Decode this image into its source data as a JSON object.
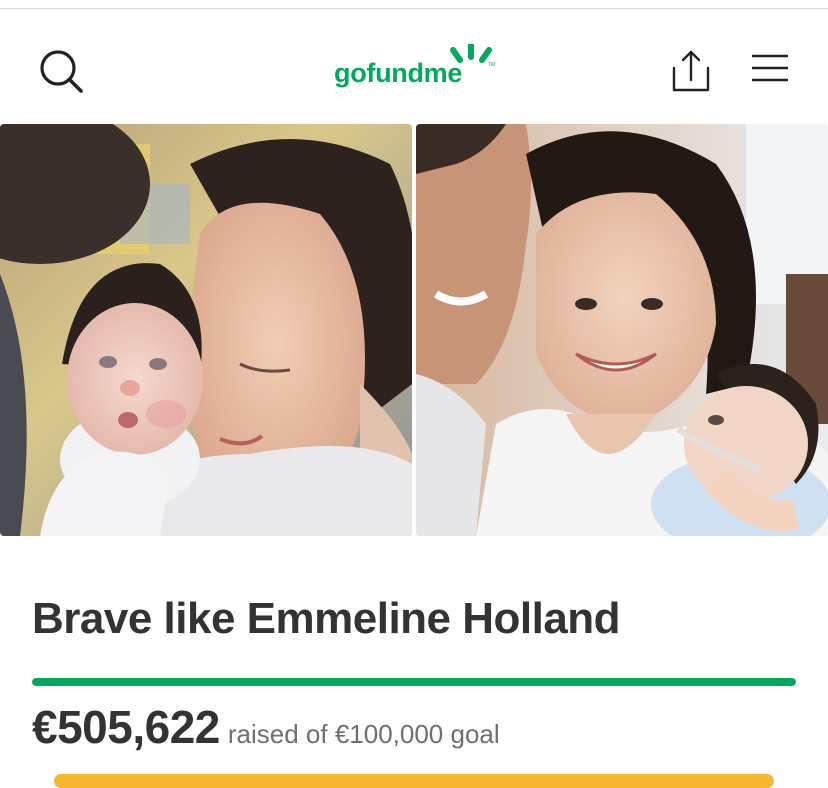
{
  "header": {
    "logo_text": "gofundme",
    "logo_tm": "TM",
    "icons": [
      "search-icon",
      "share-icon",
      "hamburger-menu-icon"
    ]
  },
  "colors": {
    "brand_green": "#02a95c",
    "title_text": "#333333",
    "secondary_text": "#6f6f6f",
    "cta_yellow": "#f7b733"
  },
  "campaign": {
    "title": "Brave like Emmeline Holland",
    "raised_amount": "€505,622",
    "goal_text": "raised of €100,000 goal",
    "progress_fraction": 1.0
  }
}
